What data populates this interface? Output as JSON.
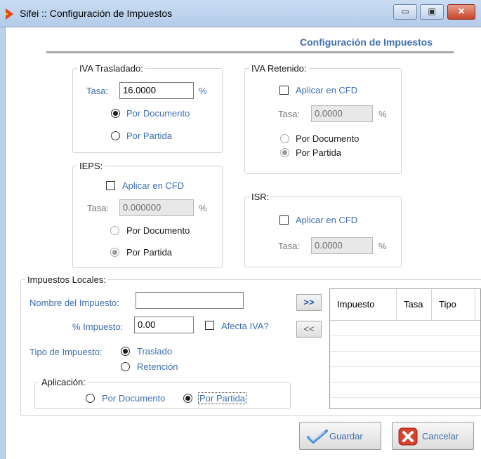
{
  "window": {
    "title": "Sifei :: Configuración de Impuestos",
    "minimize_label": "▭",
    "maximize_label": "▣",
    "close_label": "✕"
  },
  "header": {
    "title": "Configuración de Impuestos"
  },
  "iva_trasladado": {
    "legend": "IVA Trasladado:",
    "tasa_label": "Tasa:",
    "tasa_value": "16.0000",
    "percent": "%",
    "options": [
      "Por Documento",
      "Por Partida"
    ],
    "selected": "Por Documento"
  },
  "iva_retenido": {
    "legend": "IVA Retenido:",
    "aplicar_label": "Aplicar en CFD",
    "aplicar_checked": false,
    "tasa_label": "Tasa:",
    "tasa_value": "0.0000",
    "percent": "%",
    "options": [
      "Por Documento",
      "Por Partida"
    ],
    "selected": "Por Partida"
  },
  "ieps": {
    "legend": "IEPS:",
    "aplicar_label": "Aplicar en CFD",
    "aplicar_checked": false,
    "tasa_label": "Tasa:",
    "tasa_value": "0.000000",
    "percent": "%",
    "options": [
      "Por Documento",
      "Por Partida"
    ],
    "selected": "Por Partida"
  },
  "isr": {
    "legend": "ISR:",
    "aplicar_label": "Aplicar en CFD",
    "aplicar_checked": false,
    "tasa_label": "Tasa:",
    "tasa_value": "0.0000",
    "percent": "%"
  },
  "locales": {
    "legend": "Impuestos Locales:",
    "nombre_label": "Nombre del Impuesto:",
    "nombre_value": "",
    "porcentaje_label": "% Impuesto:",
    "porcentaje_value": "0.00",
    "afecta_label": "Afecta IVA?",
    "afecta_checked": false,
    "tipo_label": "Tipo de Impuesto:",
    "tipo_options": [
      "Traslado",
      "Retención"
    ],
    "tipo_selected": "Traslado",
    "aplicacion_legend": "Aplicación:",
    "aplicacion_options": [
      "Por Documento",
      "Por Partida"
    ],
    "aplicacion_selected": "Por Partida",
    "add_button": ">>",
    "remove_button": "<<",
    "grid_columns": [
      "Impuesto",
      "Tasa",
      "Tipo"
    ]
  },
  "footer": {
    "save_label": "Guardar",
    "cancel_label": "Cancelar"
  },
  "colors": {
    "accent": "#3d6fb0",
    "cancel_icon": "#d8412c",
    "save_icon": "#4a8fd4"
  }
}
